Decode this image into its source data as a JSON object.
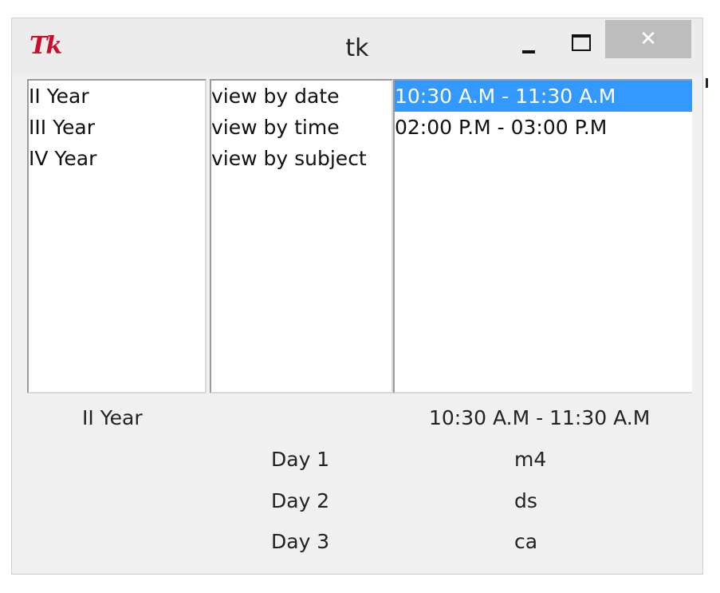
{
  "window": {
    "title": "tk",
    "logo_text": "Tk",
    "close_glyph": "✕"
  },
  "lists": {
    "years": [
      {
        "label": "II Year",
        "selected": false
      },
      {
        "label": "III Year",
        "selected": false
      },
      {
        "label": "IV Year",
        "selected": false
      }
    ],
    "views": [
      {
        "label": "view by date",
        "selected": false
      },
      {
        "label": "view by time",
        "selected": false
      },
      {
        "label": "view by subject",
        "selected": false
      }
    ],
    "times": [
      {
        "label": "10:30 A.M - 11:30 A.M",
        "selected": true
      },
      {
        "label": "02:00 P.M - 03:00 P.M",
        "selected": false
      }
    ]
  },
  "summary": {
    "selected_year": "II Year",
    "selected_time": "10:30 A.M - 11:30 A.M",
    "days": [
      {
        "day": "Day 1",
        "subject": "m4"
      },
      {
        "day": "Day 2",
        "subject": "ds"
      },
      {
        "day": "Day 3",
        "subject": "ca"
      }
    ]
  },
  "colors": {
    "selection": "#3399ff",
    "logo": "#c8102e",
    "close_button": "#bdbdbd"
  }
}
